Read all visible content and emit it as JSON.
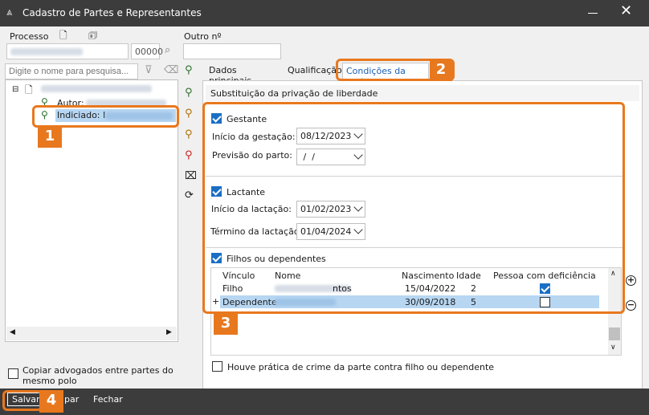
{
  "window": {
    "title": "Cadastro de Partes e Representantes"
  },
  "header": {
    "processo_label": "Processo",
    "processo_suffix": "00000",
    "outro_label": "Outro nº"
  },
  "search": {
    "placeholder": "Digite o nome para pesquisa..."
  },
  "tree": {
    "autor_label": "Autor:",
    "indiciado_label": "Indiciado: I"
  },
  "tabs": [
    {
      "label": "Dados principais"
    },
    {
      "label": "Qualificação"
    },
    {
      "label": "Condições da parte"
    }
  ],
  "panel": {
    "section_title": "Substituição da privação de liberdade",
    "gestante": {
      "label": "Gestante",
      "inicio_label": "Início da gestação:",
      "inicio_value": "08/12/2023",
      "previsao_label": "Previsão do parto:",
      "previsao_value": " /  /"
    },
    "lactante": {
      "label": "Lactante",
      "inicio_label": "Início da lactação:",
      "inicio_value": "01/02/2023",
      "termino_label": "Término da lactação:",
      "termino_value": "01/04/2024"
    },
    "filhos": {
      "label": "Filhos ou dependentes",
      "columns": [
        "Vínculo",
        "Nome",
        "Nascimento",
        "Idade",
        "Pessoa com deficiência"
      ],
      "rows": [
        {
          "vinculo": "Filho",
          "nome_tail": "ntos",
          "nascimento": "15/04/2022",
          "idade": "2",
          "deficiencia": true
        },
        {
          "vinculo": "Dependente",
          "nome_tail": "",
          "nascimento": "30/09/2018",
          "idade": "5",
          "deficiencia": false
        }
      ]
    },
    "crime_label": "Houve prática de crime da parte contra filho ou dependente"
  },
  "copiar_label": "Copiar advogados entre partes do mesmo polo",
  "footer": {
    "salvar": "Salvar",
    "limpar": "par",
    "fechar": "Fechar"
  },
  "badges": [
    "1",
    "2",
    "3",
    "4"
  ],
  "colors": {
    "accent": "#e8781e",
    "titlebar": "#3c3c3c",
    "checkbox": "#1a6fc4",
    "selection": "#b7d6f2"
  }
}
